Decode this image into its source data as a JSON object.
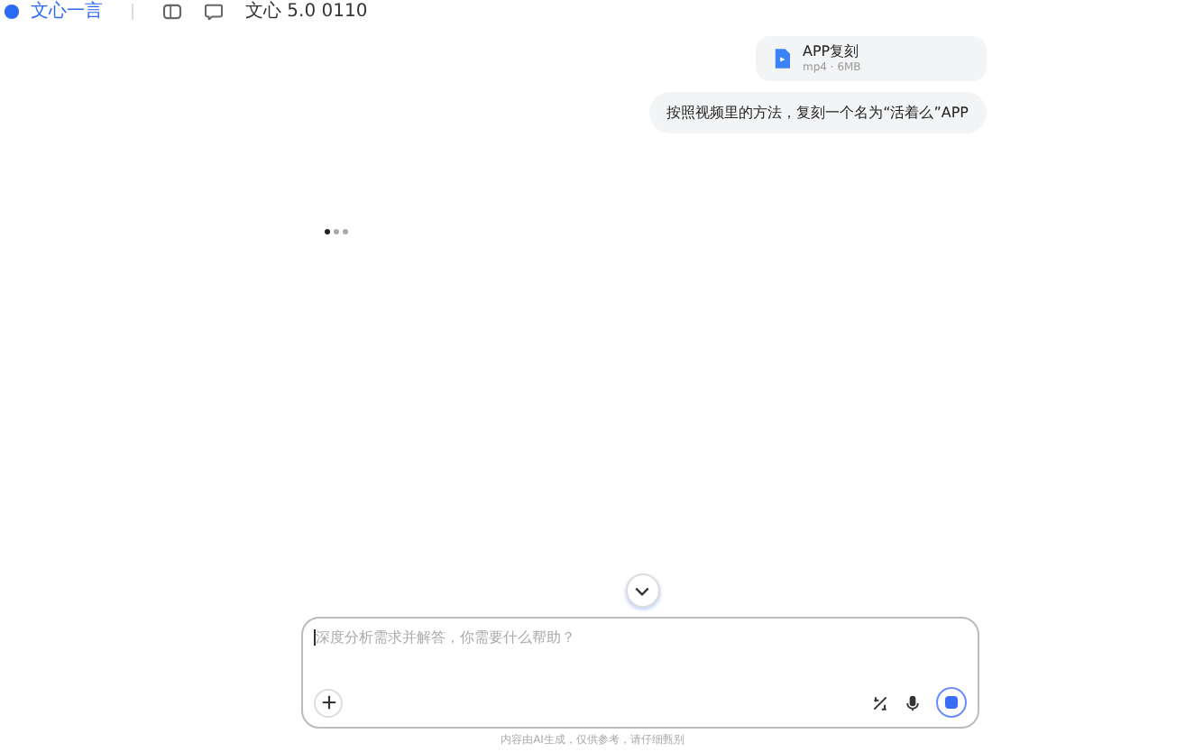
{
  "header": {
    "app_name": "文心一言",
    "model": "文心 5.0 0110"
  },
  "messages": [
    {
      "kind": "file",
      "name": "APP复刻",
      "meta": "mp4 · 6MB"
    },
    {
      "kind": "text",
      "text": "按照视频里的方法，复刻一个名为“活着么”APP"
    }
  ],
  "loading": true,
  "composer": {
    "placeholder": "深度分析需求并解答，你需要什么帮助？"
  },
  "disclaimer": "内容由AI生成，仅供参考，请仔细甄别"
}
